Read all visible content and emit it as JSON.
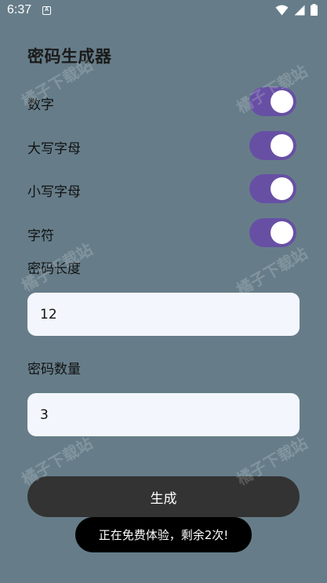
{
  "status_bar": {
    "time": "6:37",
    "badge": "A",
    "icons": [
      "wifi-icon",
      "signal-icon",
      "battery-icon"
    ]
  },
  "title": "密码生成器",
  "options": [
    {
      "label": "数字",
      "enabled": true
    },
    {
      "label": "大写字母",
      "enabled": true
    },
    {
      "label": "小写字母",
      "enabled": true
    },
    {
      "label": "字符",
      "enabled": true
    }
  ],
  "length_field": {
    "label": "密码长度",
    "value": "12"
  },
  "count_field": {
    "label": "密码数量",
    "value": "3"
  },
  "generate_label": "生成",
  "toast": "正在免费体验，剩余2次!",
  "watermark": "橘子下载站",
  "colors": {
    "background": "#667d89",
    "toggle_on": "#6750a4",
    "button": "#333333",
    "input_bg": "#f3f7fd"
  }
}
